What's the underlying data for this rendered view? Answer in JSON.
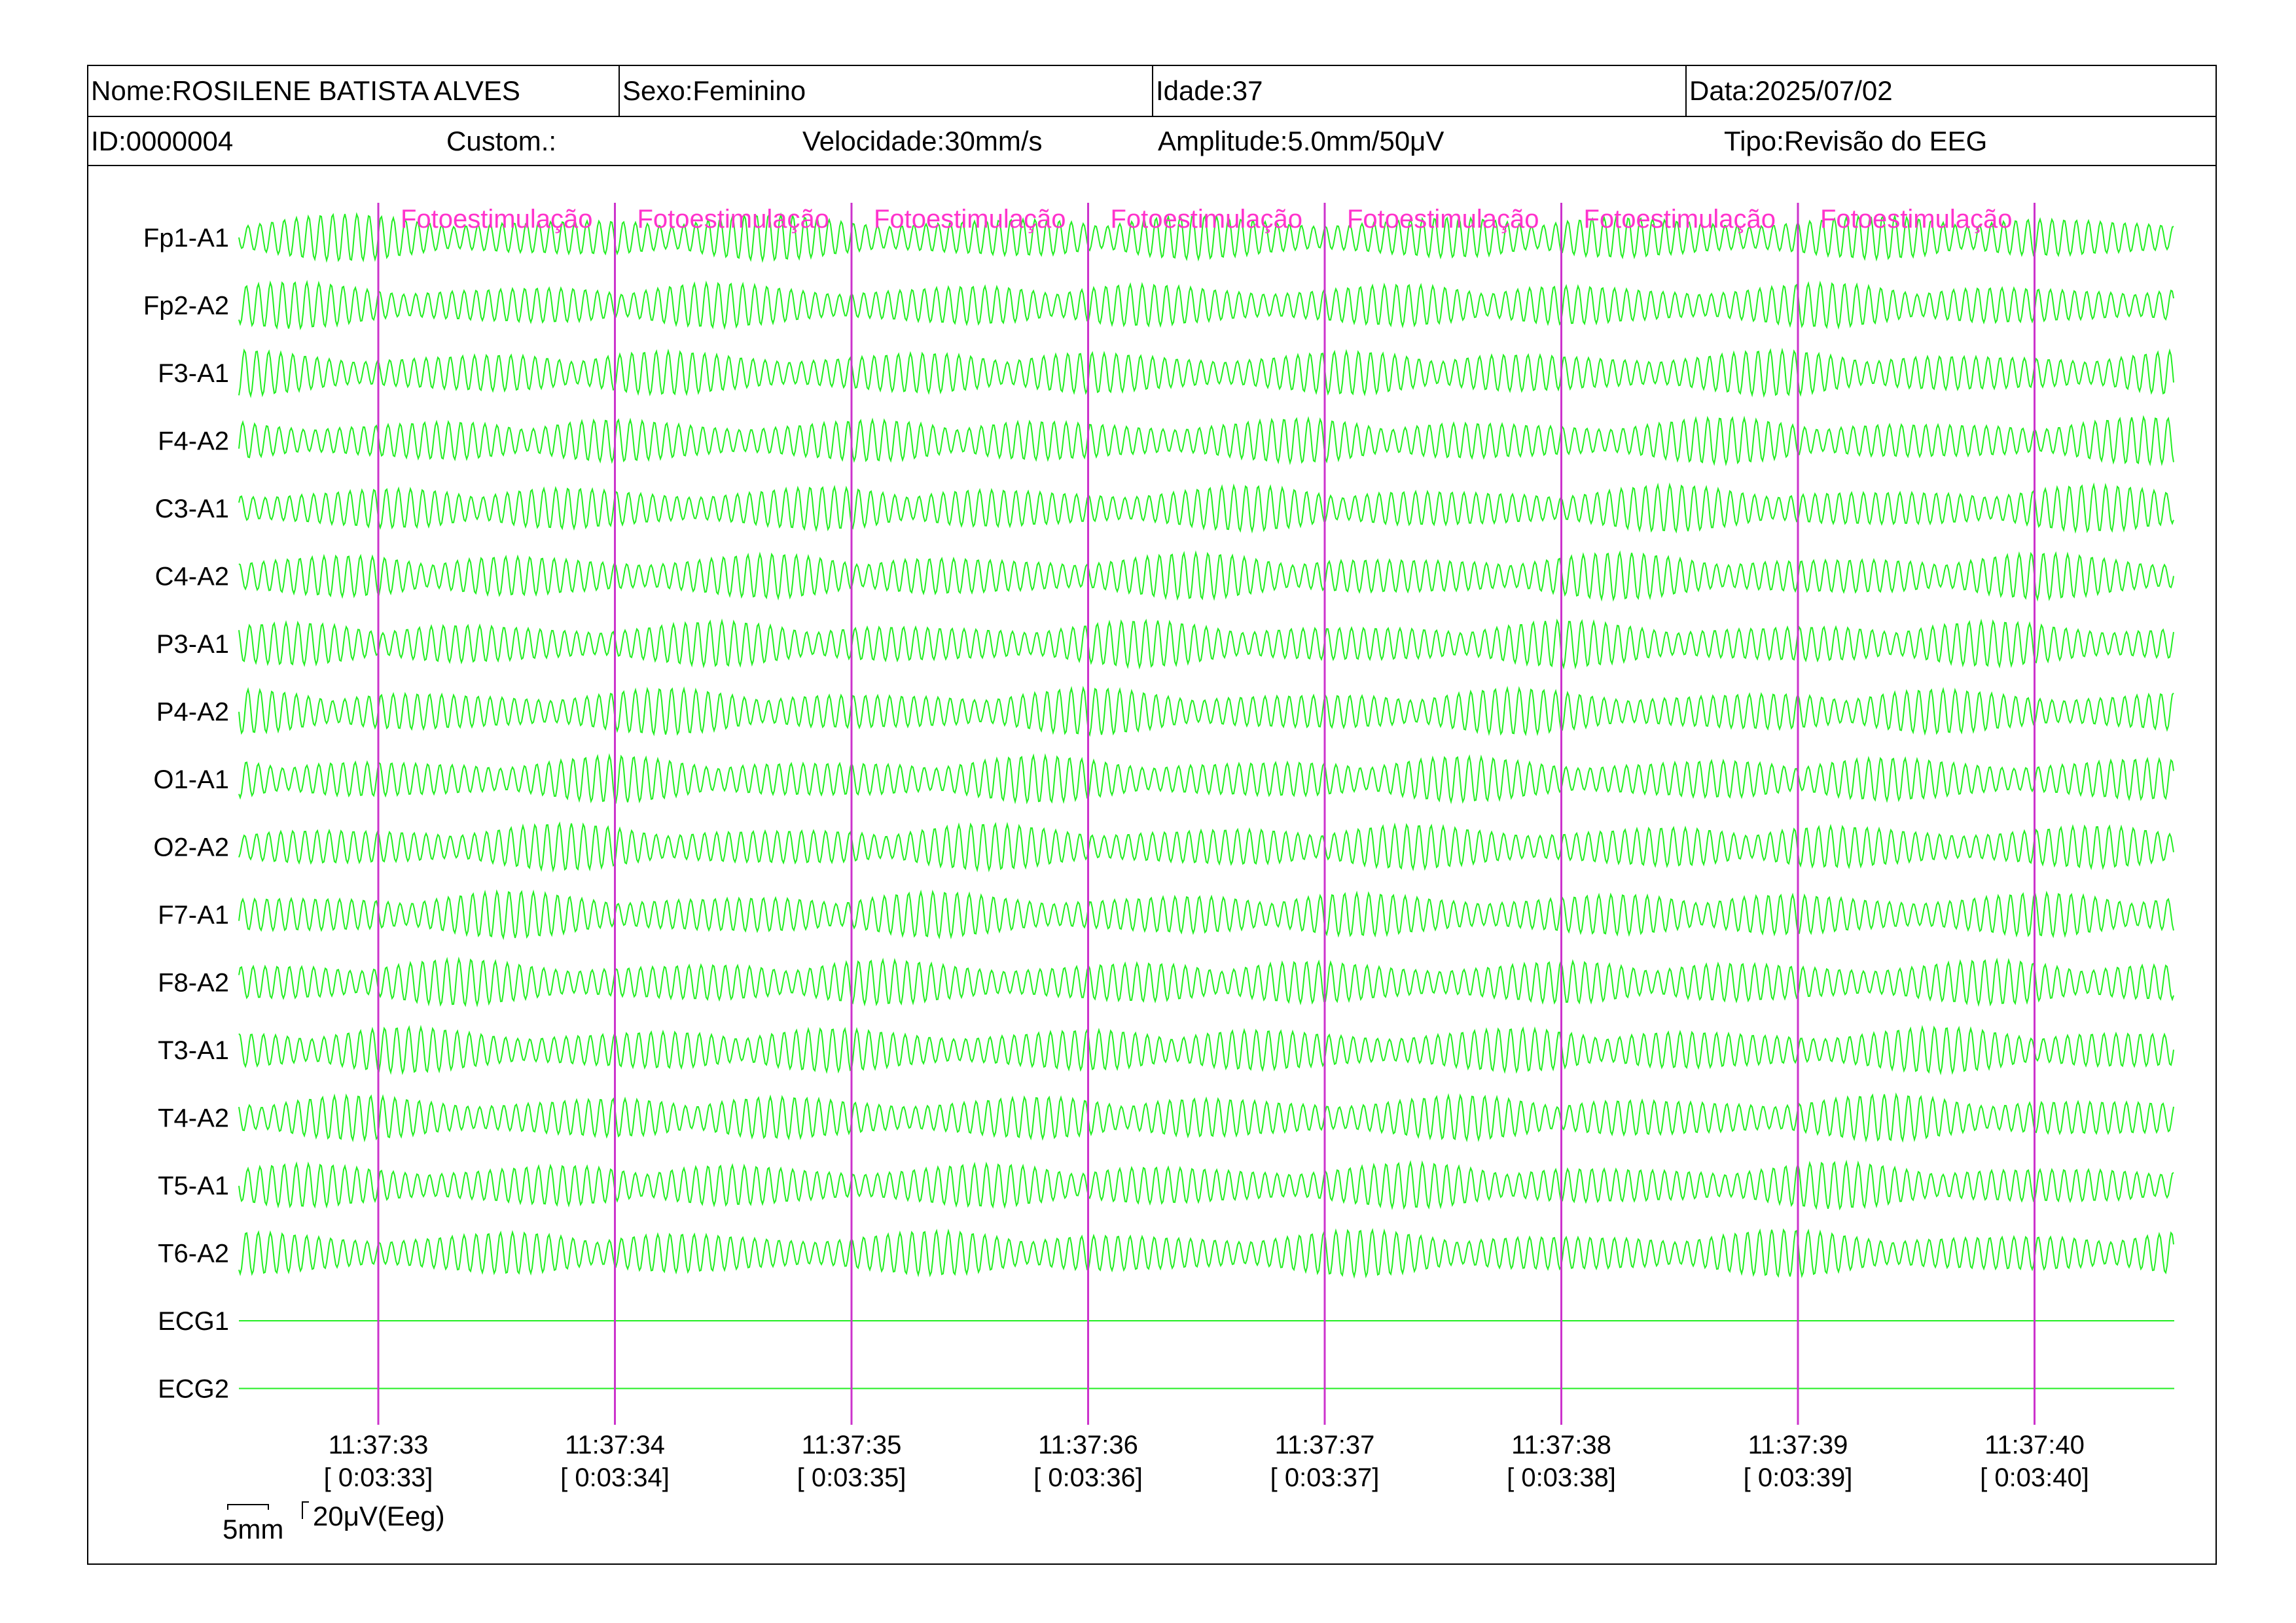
{
  "header": {
    "name": "Nome:ROSILENE BATISTA ALVES",
    "sex": "Sexo:Feminino",
    "age": "Idade:37",
    "date": "Data:2025/07/02",
    "id": "ID:0000004",
    "custom": "Custom.:",
    "speed": "Velocidade:30mm/s",
    "amplitude": "Amplitude:5.0mm/50μV",
    "type": "Tipo:Revisão do EEG"
  },
  "channels": [
    "Fp1-A1",
    "Fp2-A2",
    "F3-A1",
    "F4-A2",
    "C3-A1",
    "C4-A2",
    "P3-A1",
    "P4-A2",
    "O1-A1",
    "O2-A2",
    "F7-A1",
    "F8-A2",
    "T3-A1",
    "T4-A2",
    "T5-A1",
    "T6-A2",
    "ECG1",
    "ECG2"
  ],
  "flat_channels": [
    "ECG1",
    "ECG2"
  ],
  "event_label": "Fotoestimulação",
  "timeline": [
    {
      "time": "11:37:33",
      "elapsed": "[ 0:03:33]"
    },
    {
      "time": "11:37:34",
      "elapsed": "[ 0:03:34]"
    },
    {
      "time": "11:37:35",
      "elapsed": "[ 0:03:35]"
    },
    {
      "time": "11:37:36",
      "elapsed": "[ 0:03:36]"
    },
    {
      "time": "11:37:37",
      "elapsed": "[ 0:03:37]"
    },
    {
      "time": "11:37:38",
      "elapsed": "[ 0:03:38]"
    },
    {
      "time": "11:37:39",
      "elapsed": "[ 0:03:39]"
    },
    {
      "time": "11:37:40",
      "elapsed": "[ 0:03:40]"
    }
  ],
  "scale": {
    "time_label": "5mm",
    "amp_label": "20μV(Eeg)"
  },
  "colors": {
    "trace": "#22ee22",
    "marker": "#cc33cc",
    "event_text": "#ff33cc"
  }
}
